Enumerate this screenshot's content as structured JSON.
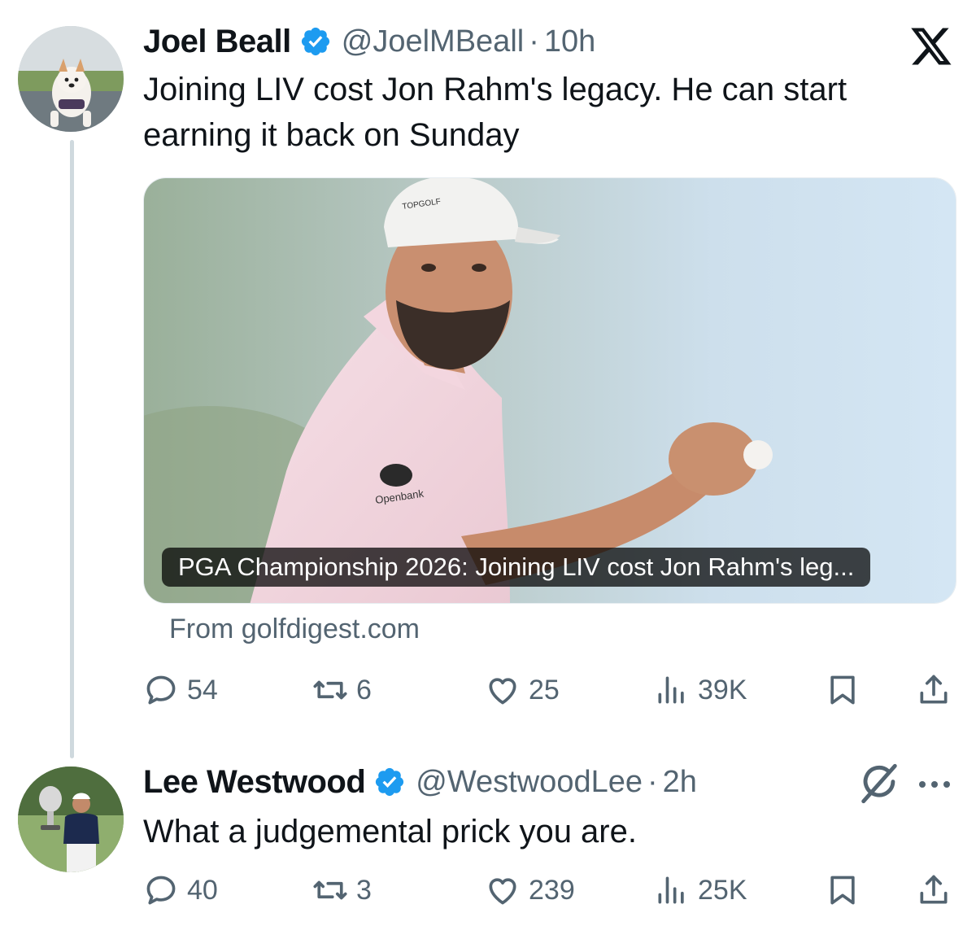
{
  "tweet": {
    "author_name": "Joel Beall",
    "handle": "@JoelMBeall",
    "separator": "·",
    "time": "10h",
    "text_line1": "Joining LIV cost Jon Rahm's legacy. He can start",
    "text_line2": "earning it back on Sunday",
    "card": {
      "caption": "PGA Championship 2026: Joining LIV cost Jon Rahm's leg...",
      "source": "From golfdigest.com",
      "cap_brand": "TOPGOLF",
      "shirt_brand": "Openbank"
    },
    "stats": {
      "replies": "54",
      "reposts": "6",
      "likes": "25",
      "views": "39K"
    }
  },
  "reply": {
    "author_name": "Lee Westwood",
    "handle": "@WestwoodLee",
    "separator": "·",
    "time": "2h",
    "text": "What a judgemental prick you are.",
    "stats": {
      "replies": "40",
      "reposts": "3",
      "likes": "239",
      "views": "25K"
    }
  },
  "icons": {
    "platform": "x-logo-icon",
    "verified": "verified-badge-icon",
    "reply": "reply-icon",
    "repost": "repost-icon",
    "like": "heart-icon",
    "views": "views-icon",
    "bookmark": "bookmark-icon",
    "share": "share-icon",
    "grok": "grok-icon",
    "more": "more-icon"
  },
  "colors": {
    "text": "#0f1419",
    "secondary": "#536471",
    "verified": "#1d9bf0",
    "thread_line": "#cfd9de"
  }
}
